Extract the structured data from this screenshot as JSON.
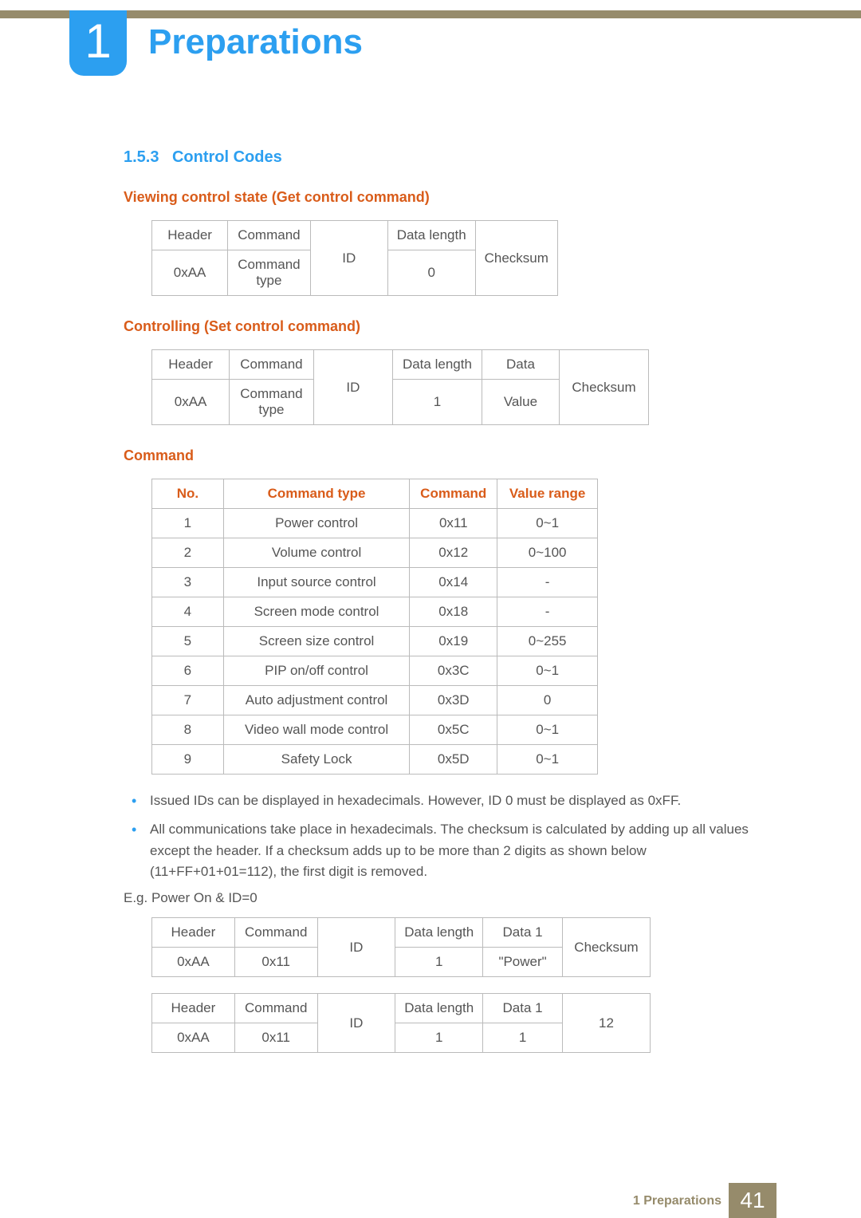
{
  "chapter": {
    "number": "1",
    "title": "Preparations"
  },
  "section": {
    "num": "1.5.3",
    "title": "Control Codes"
  },
  "sub1": "Viewing control state (Get control command)",
  "sub2": "Controlling (Set control command)",
  "sub3": "Command",
  "t1": {
    "r1": {
      "c1": "Header",
      "c2": "Command",
      "c3_merge": "ID",
      "c4": "Data length",
      "c5_merge": "Checksum"
    },
    "r2": {
      "c1": "0xAA",
      "c2": "Command type",
      "c4": "0"
    }
  },
  "t2": {
    "r1": {
      "c1": "Header",
      "c2": "Command",
      "c3_merge": "ID",
      "c4": "Data length",
      "c5": "Data",
      "c6_merge": "Checksum"
    },
    "r2": {
      "c1": "0xAA",
      "c2": "Command type",
      "c4": "1",
      "c5": "Value"
    }
  },
  "t3": {
    "head": {
      "no": "No.",
      "ct": "Command type",
      "cmd": "Command",
      "vr": "Value range"
    },
    "rows": [
      {
        "no": "1",
        "ct": "Power control",
        "cmd": "0x11",
        "vr": "0~1"
      },
      {
        "no": "2",
        "ct": "Volume control",
        "cmd": "0x12",
        "vr": "0~100"
      },
      {
        "no": "3",
        "ct": "Input source control",
        "cmd": "0x14",
        "vr": "-"
      },
      {
        "no": "4",
        "ct": "Screen mode control",
        "cmd": "0x18",
        "vr": "-"
      },
      {
        "no": "5",
        "ct": "Screen size control",
        "cmd": "0x19",
        "vr": "0~255"
      },
      {
        "no": "6",
        "ct": "PIP on/off control",
        "cmd": "0x3C",
        "vr": "0~1"
      },
      {
        "no": "7",
        "ct": "Auto adjustment control",
        "cmd": "0x3D",
        "vr": "0"
      },
      {
        "no": "8",
        "ct": "Video wall mode control",
        "cmd": "0x5C",
        "vr": "0~1"
      },
      {
        "no": "9",
        "ct": "Safety Lock",
        "cmd": "0x5D",
        "vr": "0~1"
      }
    ]
  },
  "bullets": [
    "Issued IDs can be displayed in hexadecimals. However, ID 0 must be displayed as 0xFF.",
    "All communications take place in hexadecimals. The checksum is calculated by adding up all values except the header. If a checksum adds up to be more than 2 digits as shown below (11+FF+01+01=112), the first digit is removed."
  ],
  "eg": "E.g. Power On & ID=0",
  "t4": {
    "r1": {
      "c1": "Header",
      "c2": "Command",
      "c3_merge": "ID",
      "c4": "Data length",
      "c5": "Data 1",
      "c6_merge": "Checksum"
    },
    "r2": {
      "c1": "0xAA",
      "c2": "0x11",
      "c4": "1",
      "c5": "\"Power\""
    }
  },
  "t5": {
    "r1": {
      "c1": "Header",
      "c2": "Command",
      "c3_merge": "ID",
      "c4": "Data length",
      "c5": "Data 1",
      "c6_merge": "12"
    },
    "r2": {
      "c1": "0xAA",
      "c2": "0x11",
      "c4": "1",
      "c5": "1"
    }
  },
  "footer": {
    "label": "1 Preparations",
    "page": "41"
  }
}
